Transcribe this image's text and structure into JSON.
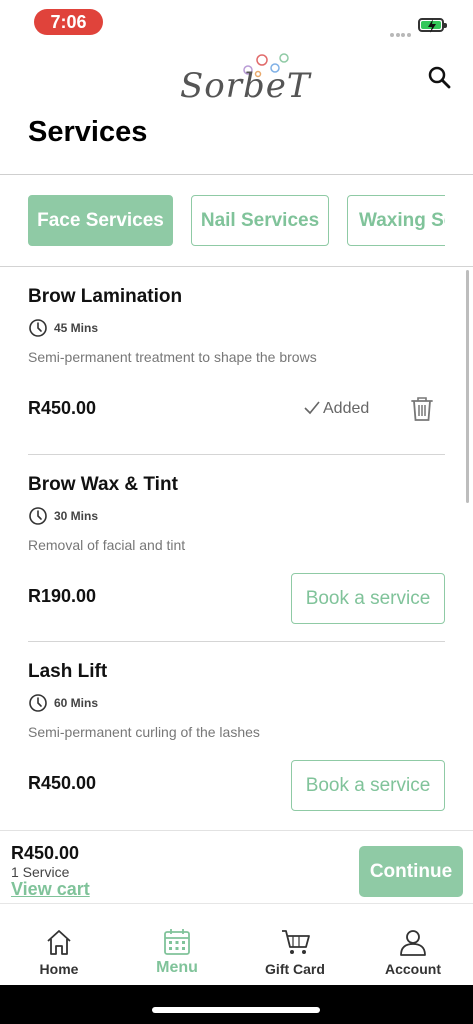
{
  "status_bar": {
    "time": "7:06"
  },
  "header": {
    "brand": "SorbeT",
    "title": "Services"
  },
  "tabs": [
    {
      "label": "Face Services",
      "active": true
    },
    {
      "label": "Nail Services",
      "active": false
    },
    {
      "label": "Waxing Se",
      "active": false
    }
  ],
  "services": [
    {
      "name": "Brow Lamination",
      "duration": "45 Mins",
      "description": "Semi-permanent treatment to shape the brows",
      "price": "R450.00",
      "status": "Added"
    },
    {
      "name": "Brow Wax & Tint",
      "duration": "30 Mins",
      "description": "Removal of facial and tint",
      "price": "R190.00",
      "action": "Book a service"
    },
    {
      "name": "Lash Lift",
      "duration": "60 Mins",
      "description": "Semi-permanent curling of the lashes",
      "price": "R450.00",
      "action": "Book a service"
    }
  ],
  "cart": {
    "total": "R450.00",
    "count": "1 Service",
    "view_cart": "View cart",
    "continue": "Continue"
  },
  "bottom_nav": [
    {
      "label": "Home",
      "icon": "home-icon"
    },
    {
      "label": "Menu",
      "icon": "calendar-icon",
      "active": true
    },
    {
      "label": "Gift Card",
      "icon": "cart-icon"
    },
    {
      "label": "Account",
      "icon": "user-icon"
    }
  ],
  "colors": {
    "accent": "#8fcaa5",
    "accent_text": "#80c39a",
    "time_pill": "#e0433b"
  }
}
